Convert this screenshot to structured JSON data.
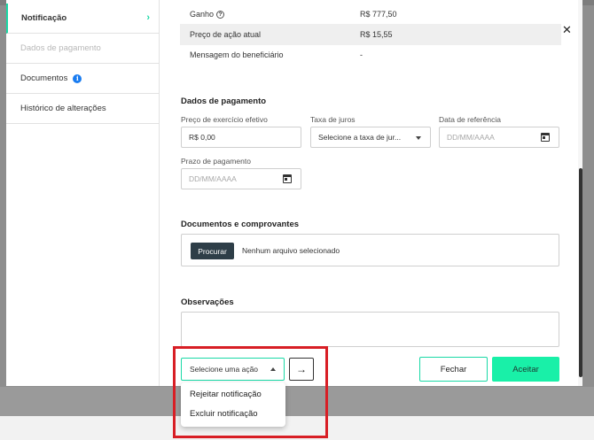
{
  "sidebar": {
    "items": [
      {
        "label": "Notificação",
        "state": "active"
      },
      {
        "label": "Dados de pagamento",
        "state": "disabled"
      },
      {
        "label": "Documentos",
        "state": "normal",
        "badge": "i"
      },
      {
        "label": "Histórico de alterações",
        "state": "normal"
      }
    ]
  },
  "details": {
    "rows": [
      {
        "label": "Ganho",
        "value": "R$ 777,50",
        "help": "?"
      },
      {
        "label": "Preço de ação atual",
        "value": "R$ 15,55"
      },
      {
        "label": "Mensagem do beneficiário",
        "value": "-"
      }
    ]
  },
  "payment": {
    "title": "Dados de pagamento",
    "strike_price": {
      "label": "Preço de exercício efetivo",
      "value": "R$ 0,00"
    },
    "interest_rate": {
      "label": "Taxa de juros",
      "value": "Selecione a taxa de jur..."
    },
    "reference_date": {
      "label": "Data de referência",
      "placeholder": "DD/MM/AAAA"
    },
    "payment_term": {
      "label": "Prazo de pagamento",
      "placeholder": "DD/MM/AAAA"
    }
  },
  "documents": {
    "title": "Documentos e comprovantes",
    "browse_label": "Procurar",
    "no_file_text": "Nenhum arquivo selecionado"
  },
  "observations": {
    "title": "Observações"
  },
  "actions": {
    "select_placeholder": "Selecione uma ação",
    "go_symbol": "→",
    "options": [
      "Rejeitar notificação",
      "Excluir notificação"
    ],
    "close_label": "Fechar",
    "accept_label": "Aceitar"
  },
  "modal": {
    "close_symbol": "✕"
  },
  "colors": {
    "accent": "#19d9a6",
    "accept": "#19f0a8",
    "browse_button": "#2e3e48",
    "highlight": "#d81e25",
    "info": "#1a7cf0"
  }
}
